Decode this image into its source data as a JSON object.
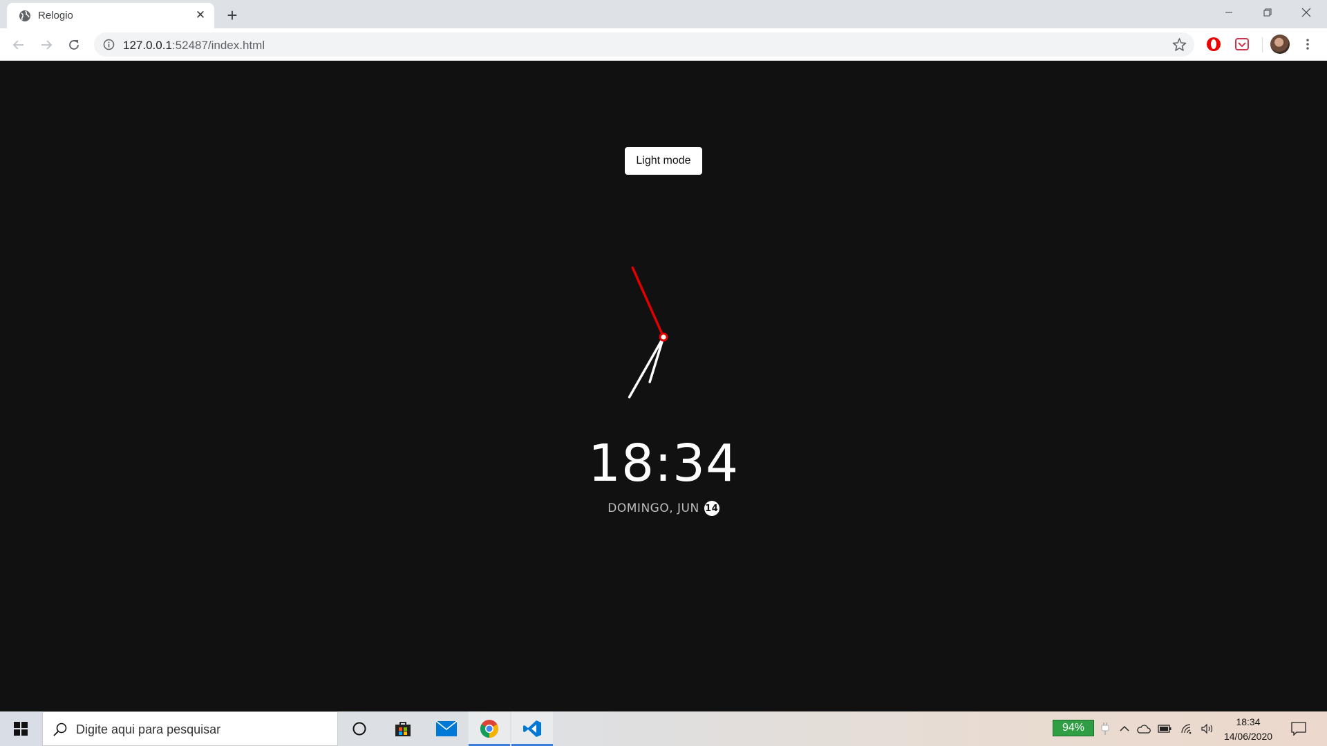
{
  "browser": {
    "tab_title": "Relogio",
    "url_host": "127.0.0.1",
    "url_rest": ":52487/index.html"
  },
  "page": {
    "theme_button_label": "Light mode",
    "time": "18:34",
    "date_text": "DOMINGO, JUN",
    "day": "14",
    "clock": {
      "hour": 18,
      "minute": 34,
      "second": 56
    },
    "colors": {
      "background": "#111111",
      "hands": "#ffffff",
      "second_hand": "#e00000"
    }
  },
  "taskbar": {
    "search_placeholder": "Digite aqui para pesquisar",
    "battery_percent": "94%",
    "clock_time": "18:34",
    "clock_date": "14/06/2020",
    "pinned_icons": [
      "cortana-icon",
      "store-icon",
      "mail-icon",
      "chrome-icon",
      "vscode-icon"
    ]
  }
}
